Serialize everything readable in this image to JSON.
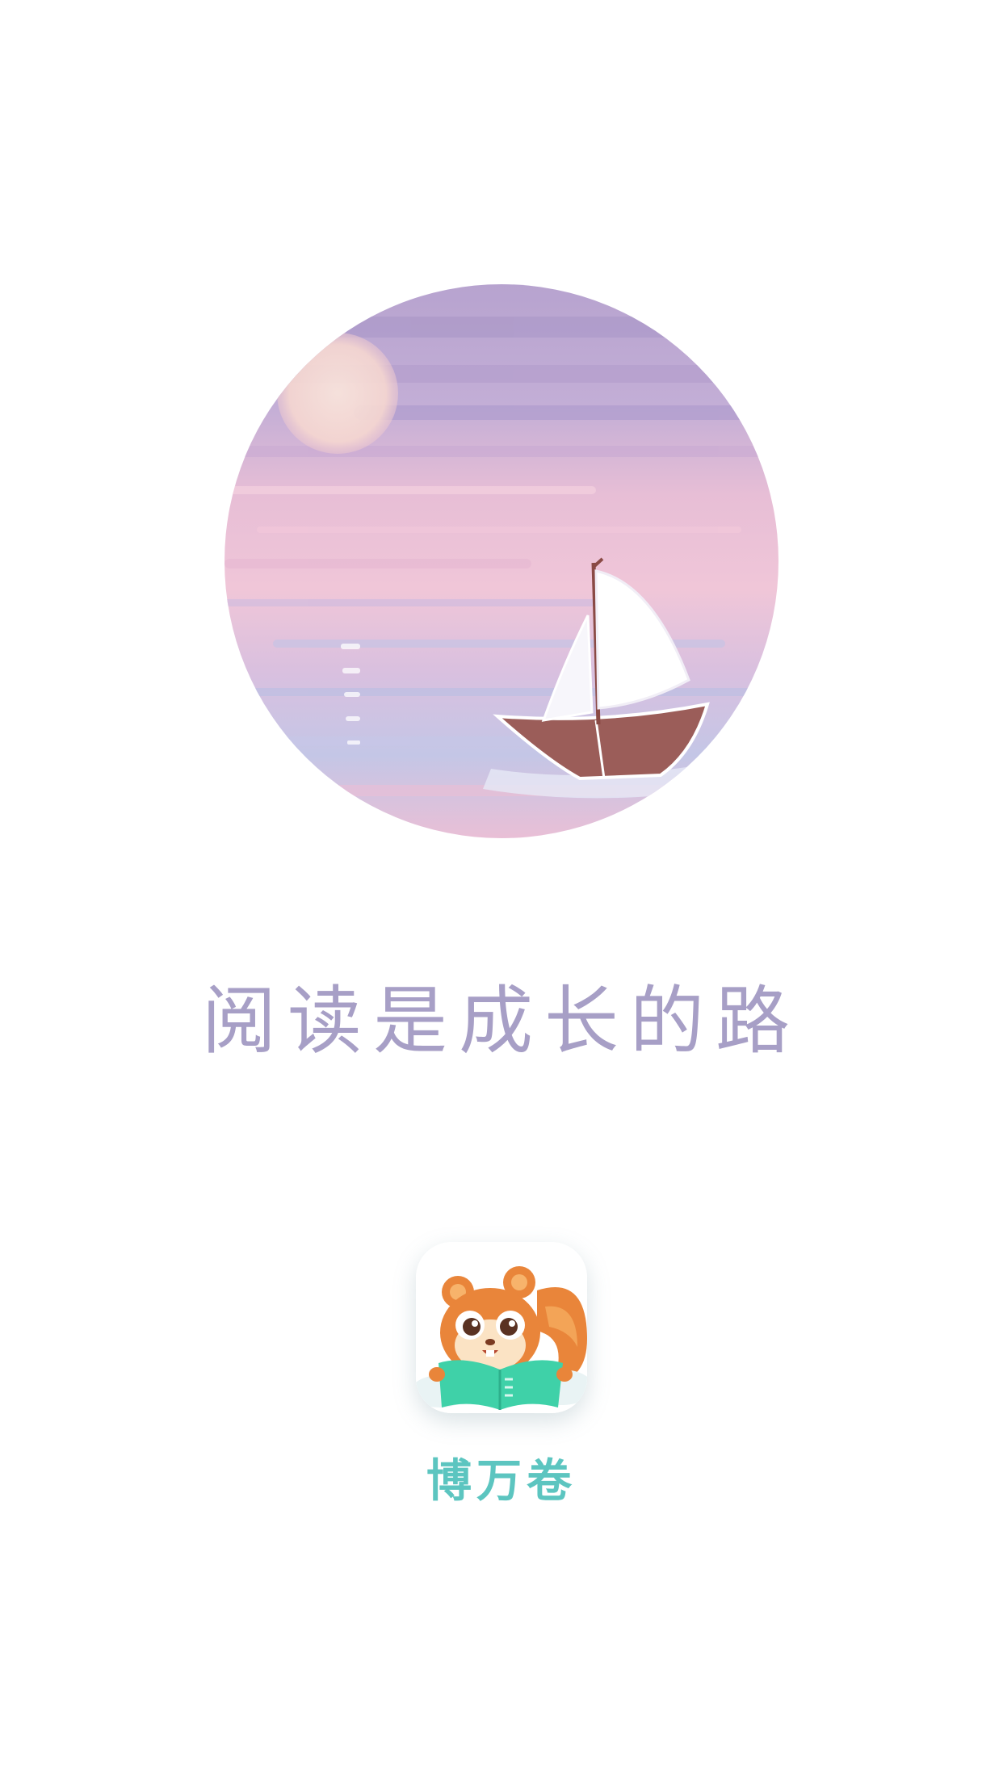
{
  "slogan": "阅读是成长的路",
  "app_name": "博万卷",
  "colors": {
    "background": "#ffffff",
    "slogan": "#a79fc6",
    "app_name": "#5cc5c0",
    "book_green": "#3fd1a8",
    "squirrel_orange": "#e9853a"
  },
  "icons": {
    "hero": "sailboat-sunset-illustration",
    "app": "squirrel-reading-book-icon"
  }
}
